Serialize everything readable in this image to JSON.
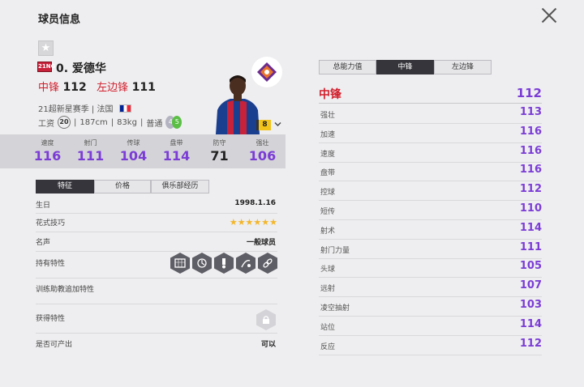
{
  "page": {
    "title": "球员信息"
  },
  "player": {
    "season_badge": "21NG",
    "name": "0. 爱德华",
    "positions": [
      {
        "pos": "中锋",
        "ovr": "112"
      },
      {
        "pos": "左边锋",
        "ovr": "111"
      }
    ],
    "meta_line1": "21超新星赛季 | 法国",
    "wage_label": "工资",
    "wage": "20",
    "height": "187cm",
    "weight": "83kg",
    "body_type": "普通",
    "weak_foot": "4",
    "strong_foot": "5",
    "enhance_level": "8"
  },
  "stats": [
    {
      "label": "速度",
      "value": "116"
    },
    {
      "label": "射门",
      "value": "111"
    },
    {
      "label": "传球",
      "value": "104"
    },
    {
      "label": "盘带",
      "value": "114"
    },
    {
      "label": "防守",
      "value": "71"
    },
    {
      "label": "强壮",
      "value": "106"
    }
  ],
  "left_tabs": [
    "特征",
    "价格",
    "俱乐部经历"
  ],
  "info_rows": {
    "birthday": {
      "label": "生日",
      "value": "1998.1.16"
    },
    "skill_moves": {
      "label": "花式技巧",
      "stars": "★★★★★★"
    },
    "reputation": {
      "label": "名声",
      "value": "一般球员"
    },
    "traits": {
      "label": "持有特性"
    },
    "coach_traits": {
      "label": "训练助教追加特性"
    },
    "acquired_traits": {
      "label": "获得特性"
    },
    "producible": {
      "label": "是否可产出",
      "value": "可以"
    }
  },
  "right_tabs": [
    "总能力值",
    "中锋",
    "左边锋"
  ],
  "attr_main": {
    "label": "中锋",
    "value": "112"
  },
  "attributes": [
    {
      "label": "强壮",
      "value": "113"
    },
    {
      "label": "加速",
      "value": "116"
    },
    {
      "label": "速度",
      "value": "116"
    },
    {
      "label": "盘带",
      "value": "116"
    },
    {
      "label": "控球",
      "value": "112"
    },
    {
      "label": "短传",
      "value": "110"
    },
    {
      "label": "射术",
      "value": "114"
    },
    {
      "label": "射门力量",
      "value": "111"
    },
    {
      "label": "头球",
      "value": "105"
    },
    {
      "label": "远射",
      "value": "107"
    },
    {
      "label": "凌空抽射",
      "value": "103"
    },
    {
      "label": "站位",
      "value": "114"
    },
    {
      "label": "反应",
      "value": "112"
    }
  ],
  "colors": {
    "accent_red": "#d21f2c",
    "stat_purple": "#7b3cd6",
    "dark_tab": "#35353b"
  }
}
